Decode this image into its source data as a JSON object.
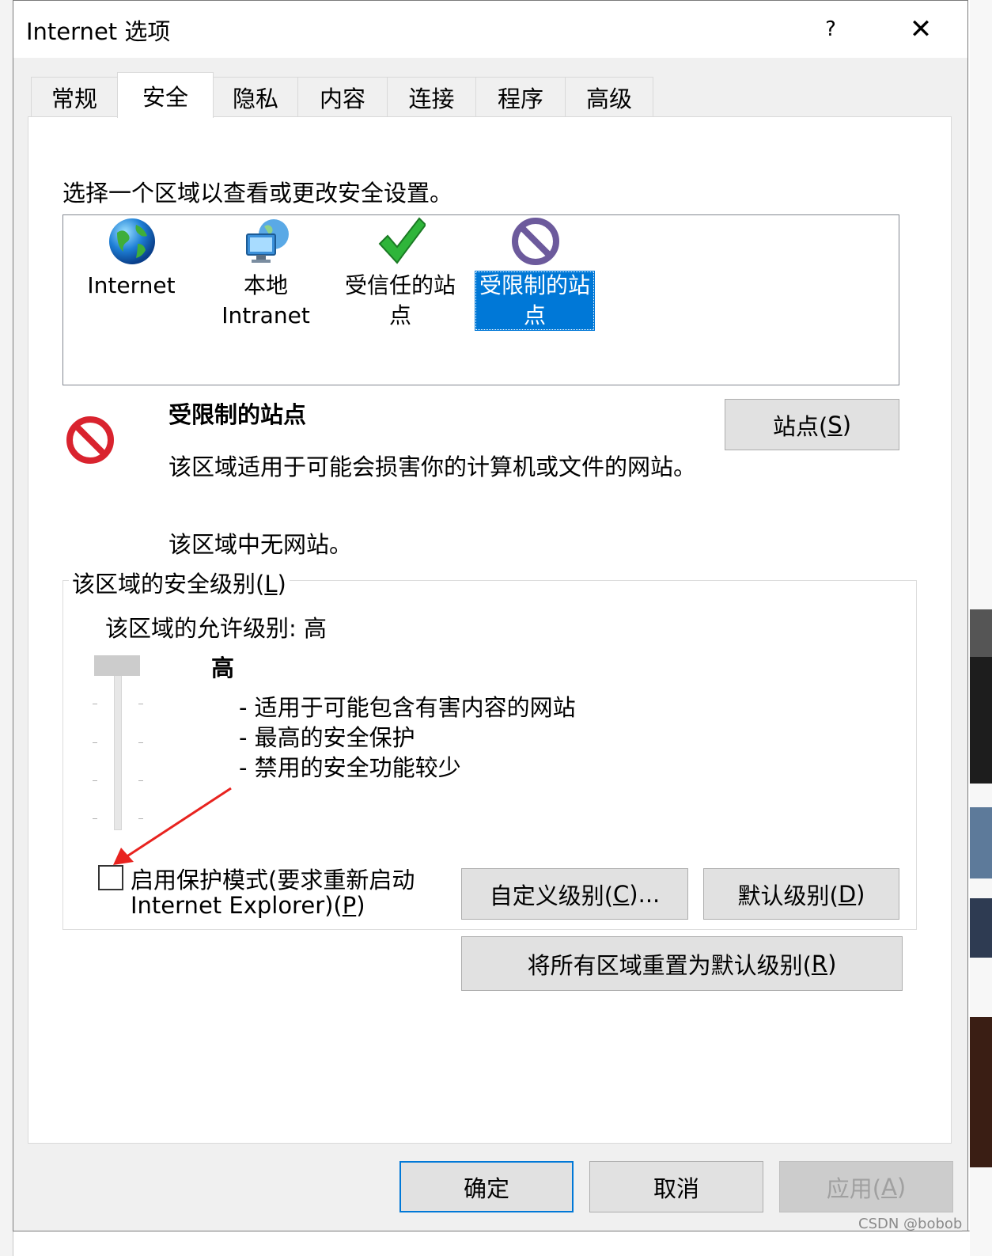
{
  "window": {
    "title": "Internet 选项",
    "help": "?",
    "close": "✕"
  },
  "tabs": [
    {
      "label": "常规",
      "active": false
    },
    {
      "label": "安全",
      "active": true
    },
    {
      "label": "隐私",
      "active": false
    },
    {
      "label": "内容",
      "active": false
    },
    {
      "label": "连接",
      "active": false
    },
    {
      "label": "程序",
      "active": false
    },
    {
      "label": "高级",
      "active": false
    }
  ],
  "security": {
    "instruction": "选择一个区域以查看或更改安全设置。",
    "zones": [
      {
        "line1": "Internet",
        "line2": "",
        "icon": "globe-icon",
        "selected": false
      },
      {
        "line1": "本地",
        "line2": "Intranet",
        "icon": "intranet-icon",
        "selected": false
      },
      {
        "line1": "受信任的站",
        "line2": "点",
        "icon": "checkmark-icon",
        "selected": false
      },
      {
        "line1": "受限制的站",
        "line2": "点",
        "icon": "restricted-icon",
        "selected": true
      }
    ],
    "zone_info": {
      "icon": "restricted-icon",
      "title": "受限制的站点",
      "description": "该区域适用于可能会损害你的计算机或文件的网站。",
      "no_sites": "该区域中无网站。",
      "sites_button": {
        "text": "站点(",
        "key": "S",
        "tail": ")"
      }
    },
    "level_group": {
      "legend": {
        "text": "该区域的安全级别(",
        "key": "L",
        "tail": ")"
      },
      "allowed": "该区域的允许级别: 高",
      "level_name": "高",
      "level_points": [
        "- 适用于可能包含有害内容的网站",
        "- 最高的安全保护",
        "- 禁用的安全功能较少"
      ],
      "slider_level": "高",
      "protected_mode": {
        "checked": false,
        "line1": "启用保护模式(要求重新启动",
        "line2_text": "Internet Explorer)(",
        "key": "P",
        "tail": ")"
      },
      "custom_button": {
        "text": "自定义级别(",
        "key": "C",
        "tail": ")..."
      },
      "default_button": {
        "text": "默认级别(",
        "key": "D",
        "tail": ")"
      }
    },
    "reset_button": {
      "text": "将所有区域重置为默认级别(",
      "key": "R",
      "tail": ")"
    }
  },
  "footer": {
    "ok": "确定",
    "cancel": "取消",
    "apply": {
      "text": "应用(",
      "key": "A",
      "tail": ")"
    }
  },
  "watermark": "CSDN @bobob_",
  "colors": {
    "selection": "#0078d7",
    "annotation_arrow": "#e8231f",
    "restricted_red": "#d9232e",
    "restricted_purple": "#6c5a9c"
  }
}
